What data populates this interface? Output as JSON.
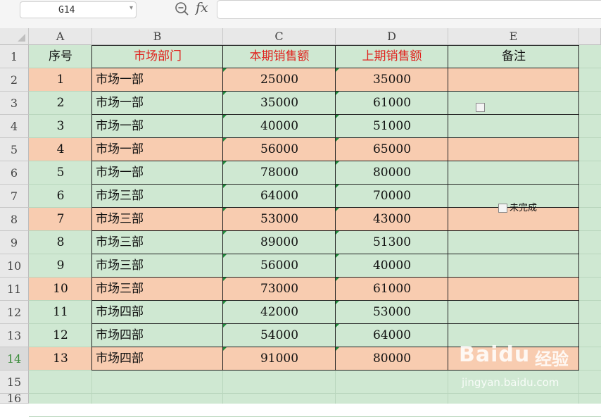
{
  "formula_bar": {
    "name_box": "G14",
    "fx_label": "fx",
    "formula": ""
  },
  "columns": [
    "A",
    "B",
    "C",
    "D",
    "E"
  ],
  "rows": [
    "1",
    "2",
    "3",
    "4",
    "5",
    "6",
    "7",
    "8",
    "9",
    "10",
    "11",
    "12",
    "13",
    "14",
    "15",
    "16"
  ],
  "table": {
    "headers": [
      "序号",
      "市场部门",
      "本期销售额",
      "上期销售额",
      "备注"
    ],
    "data": [
      [
        "1",
        "市场一部",
        "25000",
        "35000",
        ""
      ],
      [
        "2",
        "市场一部",
        "35000",
        "61000",
        ""
      ],
      [
        "3",
        "市场一部",
        "40000",
        "51000",
        ""
      ],
      [
        "4",
        "市场一部",
        "56000",
        "65000",
        ""
      ],
      [
        "5",
        "市场一部",
        "78000",
        "80000",
        ""
      ],
      [
        "6",
        "市场三部",
        "64000",
        "70000",
        ""
      ],
      [
        "7",
        "市场三部",
        "53000",
        "43000",
        ""
      ],
      [
        "8",
        "市场三部",
        "89000",
        "51300",
        ""
      ],
      [
        "9",
        "市场三部",
        "56000",
        "40000",
        ""
      ],
      [
        "10",
        "市场三部",
        "73000",
        "61000",
        ""
      ],
      [
        "11",
        "市场四部",
        "42000",
        "53000",
        ""
      ],
      [
        "12",
        "市场四部",
        "54000",
        "64000",
        ""
      ],
      [
        "13",
        "市场四部",
        "91000",
        "80000",
        ""
      ]
    ],
    "highlighted_rows": [
      1,
      4,
      7,
      10,
      13
    ]
  },
  "checkboxes": [
    {
      "label": "",
      "checked": false
    },
    {
      "label": "未完成",
      "checked": false
    }
  ],
  "active_row": "14",
  "watermark": {
    "brand": "Bai",
    "brand2": "du",
    "sub": "经验",
    "url": "jingyan.baidu.com"
  },
  "colors": {
    "sheet_green": "#cfe8d2",
    "row_highlight": "#f8ccb0",
    "header_red": "#e0201c",
    "hint_triangle": "#1e8a3a"
  }
}
